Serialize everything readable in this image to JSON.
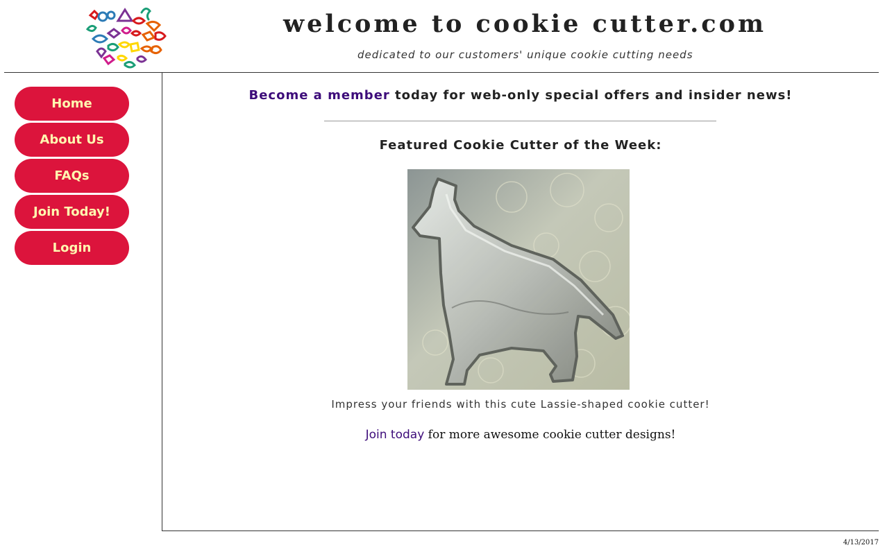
{
  "header": {
    "title": "welcome to cookie cutter.com",
    "tagline": "dedicated to our customers' unique cookie cutting needs",
    "logo_icon": "cookie-cutter-shapes-logo"
  },
  "sidebar": {
    "items": [
      {
        "label": "Home"
      },
      {
        "label": "About Us"
      },
      {
        "label": "FAQs"
      },
      {
        "label": "Join Today!"
      },
      {
        "label": "Login"
      }
    ]
  },
  "main": {
    "promo_link": "Become a member",
    "promo_text": " today for web-only special offers and insider news!",
    "featured_heading": "Featured Cookie Cutter of the Week:",
    "featured_image_icon": "dog-cookie-cutter-photo",
    "caption": "Impress your friends with this cute Lassie-shaped cookie cutter!",
    "join_link": "Join today",
    "join_text": " for more awesome cookie cutter designs!"
  },
  "footer": {
    "date": "4/13/2017"
  },
  "colors": {
    "nav_button_bg": "#dc143c",
    "nav_button_text": "#fff8b0",
    "link": "#3d0c7a"
  }
}
